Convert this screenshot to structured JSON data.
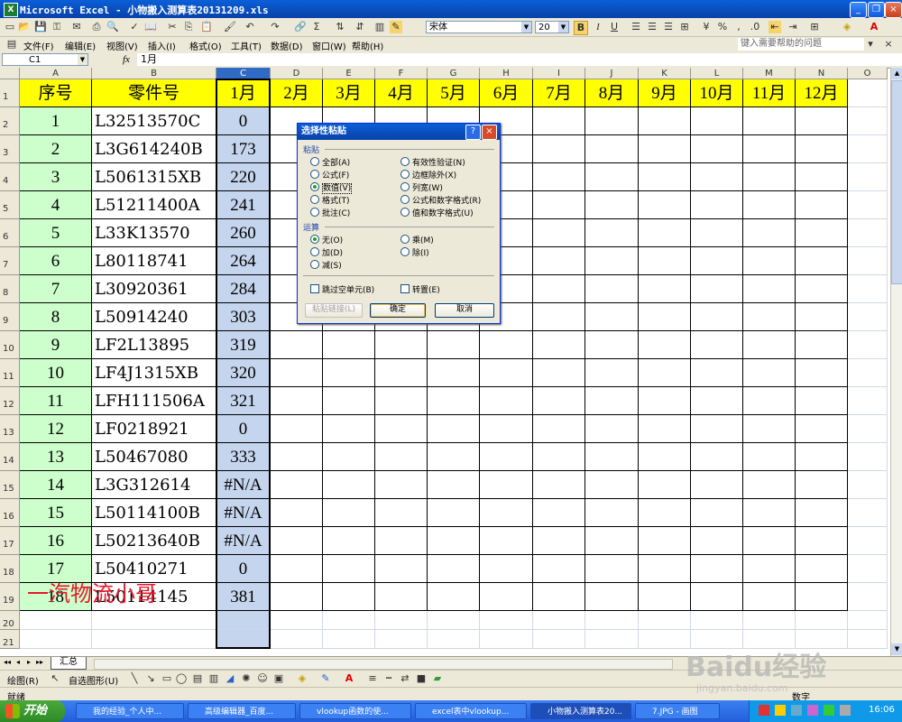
{
  "window": {
    "title": "Microsoft Excel - 小物搬入测算表20131209.xls",
    "controls": [
      "_",
      "❐",
      "×"
    ]
  },
  "toolbar": {
    "font_name": "宋体",
    "font_size": "20",
    "bold": "B",
    "italic": "I",
    "underline": "U"
  },
  "menubar": {
    "items": [
      "文件(F)",
      "编辑(E)",
      "视图(V)",
      "插入(I)",
      "格式(O)",
      "工具(T)",
      "数据(D)",
      "窗口(W)",
      "帮助(H)"
    ],
    "help_placeholder": "键入需要帮助的问题"
  },
  "formula_bar": {
    "name_box": "C1",
    "fx": "fx",
    "content": "1月"
  },
  "columns": [
    "A",
    "B",
    "C",
    "D",
    "E",
    "F",
    "G",
    "H",
    "I",
    "J",
    "K",
    "L",
    "M",
    "N",
    "O"
  ],
  "headers": [
    "序号",
    "零件号",
    "1月",
    "2月",
    "3月",
    "4月",
    "5月",
    "6月",
    "7月",
    "8月",
    "9月",
    "10月",
    "11月",
    "12月"
  ],
  "rows": [
    {
      "n": "1",
      "part": "L32513570C",
      "jan": "0"
    },
    {
      "n": "2",
      "part": "L3G614240B",
      "jan": "173"
    },
    {
      "n": "3",
      "part": "L5061315XB",
      "jan": "220"
    },
    {
      "n": "4",
      "part": "L51211400A",
      "jan": "241"
    },
    {
      "n": "5",
      "part": "L33K13570",
      "jan": "260"
    },
    {
      "n": "6",
      "part": "L80118741",
      "jan": "264"
    },
    {
      "n": "7",
      "part": "L30920361",
      "jan": "284"
    },
    {
      "n": "8",
      "part": "L50914240",
      "jan": "303"
    },
    {
      "n": "9",
      "part": "LF2L13895",
      "jan": "319"
    },
    {
      "n": "10",
      "part": "LF4J1315XB",
      "jan": "320"
    },
    {
      "n": "11",
      "part": "LFH111506A",
      "jan": "321"
    },
    {
      "n": "12",
      "part": "LF0218921",
      "jan": "0"
    },
    {
      "n": "13",
      "part": "L50467080",
      "jan": "333"
    },
    {
      "n": "14",
      "part": "L3G312614",
      "jan": "#N/A"
    },
    {
      "n": "15",
      "part": "L50114100B",
      "jan": "#N/A"
    },
    {
      "n": "16",
      "part": "L50213640B",
      "jan": "#N/A"
    },
    {
      "n": "17",
      "part": "L50410271",
      "jan": "0"
    },
    {
      "n": "18",
      "part": "L50114145",
      "jan": "381"
    }
  ],
  "row_numbers": [
    "1",
    "2",
    "3",
    "4",
    "5",
    "6",
    "7",
    "8",
    "9",
    "10",
    "11",
    "12",
    "13",
    "14",
    "15",
    "16",
    "17",
    "18",
    "19",
    "20",
    "21"
  ],
  "dialog": {
    "title": "选择性粘贴",
    "paste_group": "粘贴",
    "paste_options": [
      "全部(A)",
      "公式(F)",
      "数值(V)",
      "格式(T)",
      "批注(C)"
    ],
    "paste_options_right": [
      "有效性验证(N)",
      "边框除外(X)",
      "列宽(W)",
      "公式和数字格式(R)",
      "值和数字格式(U)"
    ],
    "paste_selected": "数值(V)",
    "op_group": "运算",
    "op_options": [
      "无(O)",
      "加(D)",
      "减(S)"
    ],
    "op_options_right": [
      "乘(M)",
      "除(I)"
    ],
    "op_selected": "无(O)",
    "skip_blanks": "跳过空单元(B)",
    "transpose": "转置(E)",
    "paste_link": "粘贴链接(L)",
    "ok": "确定",
    "cancel": "取消",
    "help": "?",
    "close": "×"
  },
  "sheet_tab": "汇总",
  "sheet_nav": [
    "◂◂",
    "◂",
    "▸",
    "▸▸"
  ],
  "drawbar": {
    "draw": "绘图(R)",
    "autoshapes": "自选图形(U)"
  },
  "status": {
    "left": "就绪",
    "right": "数字"
  },
  "watermark": "一汽物流小哥",
  "taskbar": {
    "start": "开始",
    "tasks": [
      "我的经验_个人中...",
      "高级编辑器_百度...",
      "vlookup函数的使...",
      "excel表中vlookup...",
      "小物搬入测算表20...",
      "7.JPG - 画图"
    ],
    "clock": "16:06"
  },
  "baidu": {
    "brand": "Baidu经验",
    "url": "jingyan.baidu.com"
  }
}
